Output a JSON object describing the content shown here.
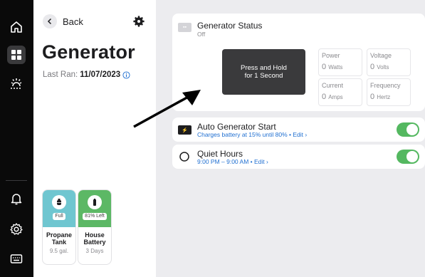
{
  "nav": {
    "items": [
      {
        "icon": "home-icon"
      },
      {
        "icon": "grid-icon",
        "active": true
      },
      {
        "icon": "sun-weather-icon"
      },
      {
        "icon": "bell-icon"
      },
      {
        "icon": "settings-icon"
      },
      {
        "icon": "keyboard-icon"
      }
    ]
  },
  "header": {
    "back_label": "Back",
    "title": "Generator",
    "last_ran_label": "Last Ran:",
    "last_ran_date": "11/07/2023"
  },
  "tanks": [
    {
      "name_line1": "Propane",
      "name_line2": "Tank",
      "badge": "Full",
      "detail": "9.5 gal.",
      "color": "#6fc6d0"
    },
    {
      "name_line1": "House",
      "name_line2": "Battery",
      "badge": "81% Left",
      "detail": "3 Days",
      "color": "#5cb865"
    }
  ],
  "generator_status": {
    "title": "Generator Status",
    "state": "Off",
    "press_line1": "Press and Hold",
    "press_line2": "for 1 Second",
    "stats": [
      {
        "label": "Power",
        "value": "0",
        "unit": "Watts"
      },
      {
        "label": "Voltage",
        "value": "0",
        "unit": "Volts"
      },
      {
        "label": "Current",
        "value": "0",
        "unit": "Amps"
      },
      {
        "label": "Frequency",
        "value": "0",
        "unit": "Hertz"
      }
    ]
  },
  "auto_start": {
    "title": "Auto Generator Start",
    "subtitle": "Charges battery at 15% until 80%",
    "edit": "Edit",
    "enabled": true
  },
  "quiet_hours": {
    "title": "Quiet Hours",
    "subtitle": "9:00 PM – 9:00 AM",
    "edit": "Edit",
    "enabled": true
  },
  "colors": {
    "accent_link": "#1f6fd1",
    "toggle_on": "#54b860",
    "rail_bg": "#0a0a0a",
    "content_bg": "#ececef"
  }
}
